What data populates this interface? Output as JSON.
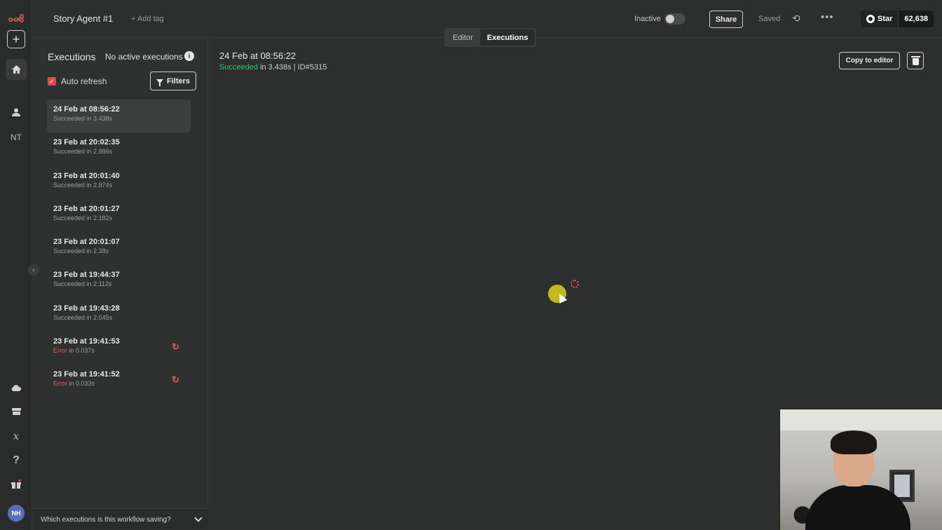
{
  "rail": {
    "nt_label": "NT",
    "avatar_initials": "NH",
    "icons": [
      "n8n-logo-icon",
      "plus-icon",
      "home-icon",
      "user-icon",
      "chevron-right-icon",
      "cloud-icon",
      "box-icon",
      "variables-icon",
      "help-icon",
      "gift-icon"
    ]
  },
  "header": {
    "workflow_title": "Story Agent #1",
    "add_tag": "+ Add tag",
    "status_label": "Inactive",
    "share_label": "Share",
    "saved_label": "Saved",
    "github_star_label": "Star",
    "github_star_count": "62,638",
    "tabs": [
      {
        "label": "Editor",
        "active": false
      },
      {
        "label": "Executions",
        "active": true
      }
    ]
  },
  "sidebar": {
    "title": "Executions",
    "active_status": "No active executions",
    "auto_refresh_label": "Auto refresh",
    "auto_refresh_checked": true,
    "filters_label": "Filters",
    "footer_question": "Which executions is this workflow saving?",
    "executions": [
      {
        "when": "24 Feb at 08:56:22",
        "status": "Succeeded",
        "duration": "in 3.438s",
        "selected": true,
        "error": false
      },
      {
        "when": "23 Feb at 20:02:35",
        "status": "Succeeded",
        "duration": "in 2.886s",
        "selected": false,
        "error": false
      },
      {
        "when": "23 Feb at 20:01:40",
        "status": "Succeeded",
        "duration": "in 2.874s",
        "selected": false,
        "error": false
      },
      {
        "when": "23 Feb at 20:01:27",
        "status": "Succeeded",
        "duration": "in 2.182s",
        "selected": false,
        "error": false
      },
      {
        "when": "23 Feb at 20:01:07",
        "status": "Succeeded",
        "duration": "in 2.38s",
        "selected": false,
        "error": false
      },
      {
        "when": "23 Feb at 19:44:37",
        "status": "Succeeded",
        "duration": "in 2.112s",
        "selected": false,
        "error": false
      },
      {
        "when": "23 Feb at 19:43:28",
        "status": "Succeeded",
        "duration": "in 2.045s",
        "selected": false,
        "error": false
      },
      {
        "when": "23 Feb at 19:41:53",
        "status": "Error",
        "duration": "in 0.037s",
        "selected": false,
        "error": true
      },
      {
        "when": "23 Feb at 19:41:52",
        "status": "Error",
        "duration": "in 0.033s",
        "selected": false,
        "error": true
      }
    ]
  },
  "detail": {
    "date": "24 Feb at 08:56:22",
    "status": "Succeeded",
    "rest": " in 3.438s | ID#5315",
    "copy_label": "Copy to editor"
  },
  "colors": {
    "success": "#3fbf6f",
    "error": "#e35d5d",
    "accent": "#e04c4c"
  }
}
